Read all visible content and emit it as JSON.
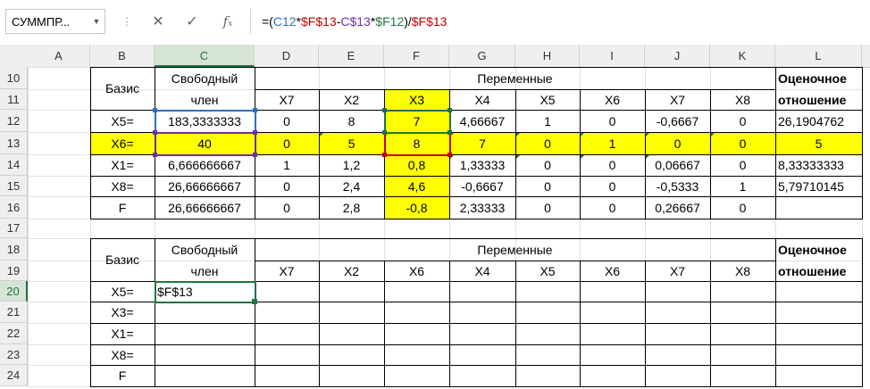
{
  "formula_bar": {
    "name_box": "СУММПР...",
    "cancel_glyph": "✕",
    "enter_glyph": "✓",
    "fx_glyph": "f",
    "fx_sub": "x",
    "formula_parts": [
      {
        "text": "=(",
        "color": "#000000"
      },
      {
        "text": "C12",
        "color": "#2f6ebd"
      },
      {
        "text": "*",
        "color": "#000000"
      },
      {
        "text": "$F$13",
        "color": "#c00000"
      },
      {
        "text": "-",
        "color": "#000000"
      },
      {
        "text": "C$13",
        "color": "#7030a0"
      },
      {
        "text": "*",
        "color": "#000000"
      },
      {
        "text": "$F12",
        "color": "#217346"
      },
      {
        "text": ")/",
        "color": "#000000"
      },
      {
        "text": "$F$13",
        "color": "#c00000"
      }
    ]
  },
  "columns": [
    "A",
    "B",
    "C",
    "D",
    "E",
    "F",
    "G",
    "H",
    "I",
    "J",
    "K",
    "L"
  ],
  "rows": [
    "10",
    "11",
    "12",
    "13",
    "14",
    "15",
    "16",
    "17",
    "18",
    "19",
    "20",
    "21",
    "22",
    "23",
    "24"
  ],
  "active": {
    "col": "C",
    "row": "20"
  },
  "colors": {
    "highlight_yellow": "#ffff00",
    "excel_green": "#217346",
    "blue_ref": "#2f6ebd",
    "red_ref": "#c00000",
    "purple_ref": "#7030a0"
  },
  "table1": {
    "basis_header": "Базис",
    "free_header_line1": "Свободный",
    "free_header_line2": "член",
    "vars_header": "Переменные",
    "ratio_header_line1": "Оценочное",
    "ratio_header_line2": "отношение",
    "var_names": [
      "X7",
      "X2",
      "X3",
      "X4",
      "X5",
      "X6",
      "X7",
      "X8"
    ],
    "rows": [
      {
        "basis": "X5=",
        "free": "183,3333333",
        "vals": [
          "0",
          "8",
          "7",
          "4,66667",
          "1",
          "0",
          "-0,6667",
          "0"
        ],
        "ratio": "26,1904762"
      },
      {
        "basis": "X6=",
        "free": "40",
        "vals": [
          "0",
          "5",
          "8",
          "7",
          "0",
          "1",
          "0",
          "0"
        ],
        "ratio": "5"
      },
      {
        "basis": "X1=",
        "free": "6,666666667",
        "vals": [
          "1",
          "1,2",
          "0,8",
          "1,33333",
          "0",
          "0",
          "0,06667",
          "0"
        ],
        "ratio": "8,33333333"
      },
      {
        "basis": "X8=",
        "free": "26,66666667",
        "vals": [
          "0",
          "2,4",
          "4,6",
          "-0,6667",
          "0",
          "0",
          "-0,5333",
          "1"
        ],
        "ratio": "5,79710145"
      },
      {
        "basis": "F",
        "free": "26,66666667",
        "vals": [
          "0",
          "2,8",
          "-0,8",
          "2,33333",
          "0",
          "0",
          "0,26667",
          "0"
        ],
        "ratio": ""
      }
    ]
  },
  "table2": {
    "basis_header": "Базис",
    "free_header_line1": "Свободный",
    "free_header_line2": "член",
    "vars_header": "Переменные",
    "ratio_header_line1": "Оценочное",
    "ratio_header_line2": "отношение",
    "var_names": [
      "X7",
      "X2",
      "X6",
      "X4",
      "X5",
      "X6",
      "X7",
      "X8"
    ],
    "rows": [
      {
        "basis": "X5=",
        "free": "$F$13"
      },
      {
        "basis": "X3=",
        "free": ""
      },
      {
        "basis": "X1=",
        "free": ""
      },
      {
        "basis": "X8=",
        "free": ""
      },
      {
        "basis": "F",
        "free": ""
      }
    ]
  }
}
